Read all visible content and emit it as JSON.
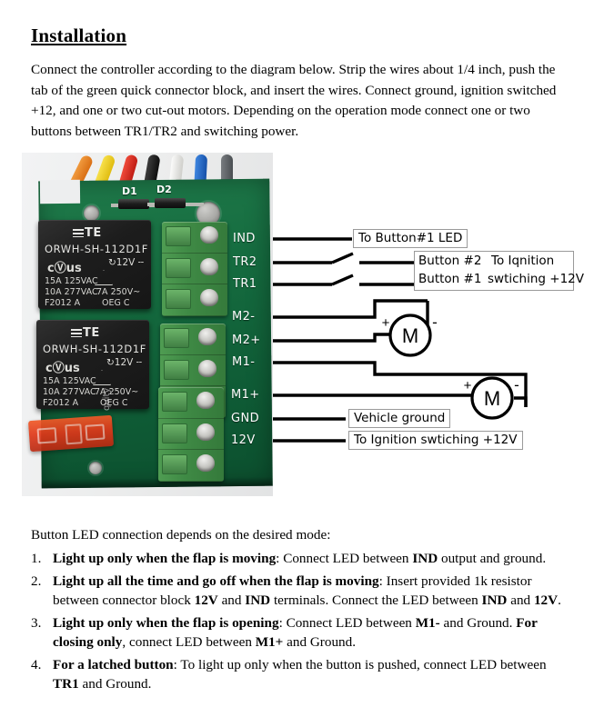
{
  "document": {
    "heading": "Installation",
    "intro": "Connect the controller according to the diagram below. Strip the wires about 1/4 inch, push the tab of the green quick connector block, and insert the wires. Connect ground, ignition switched +12, and one or two cut-out motors. Depending on the operation mode connect one or two buttons between TR1/TR2 and switching power.",
    "led_intro": "Button LED connection depends on the desired mode:",
    "led_modes": [
      {
        "number": "1.",
        "bold": "Light up only when the flap is moving",
        "rest": ": Connect LED between ",
        "term1": "IND",
        "rest2": " output and ground."
      },
      {
        "number": "2.",
        "bold": "Light up all the time and go off when the flap is moving",
        "rest": ": Insert provided 1k resistor between connector block ",
        "term1": "12V",
        "mid": " and ",
        "term2": "IND",
        "rest2": " terminals. Connect the LED between ",
        "term3": "IND",
        "mid2": " and ",
        "term4": "12V",
        "rest3": "."
      },
      {
        "number": "3.",
        "bold": "Light up only when the flap is opening",
        "rest": ": Connect LED between ",
        "term1": "M1-",
        "mid": " and Ground. ",
        "bold2": "For closing only",
        "rest2": ", connect LED between ",
        "term2": "M1+",
        "rest3": " and Ground."
      },
      {
        "number": "4.",
        "bold": "For a latched button",
        "rest": ": To light up only when the button is pushed, connect LED between ",
        "term1": "TR1",
        "rest2": " and Ground."
      }
    ]
  },
  "diagram": {
    "terminal_labels": [
      "IND",
      "TR2",
      "TR1",
      "M2-",
      "M2+",
      "M1-",
      "M1+",
      "GND",
      "12V"
    ],
    "annotations": {
      "button1_led": "To Button#1 LED",
      "button2": "Button #2",
      "button1": "Button #1",
      "to_ignition_line1": "To Iqnition",
      "to_ignition_line2": "swtiching +12V",
      "vehicle_ground": "Vehicle ground",
      "to_ignition_12v": "To Ignition swtiching +12V"
    },
    "motor_symbol": {
      "label": "M",
      "plus": "+",
      "minus": "-"
    },
    "motors": [
      {
        "name": "motor-1",
        "label": "M"
      },
      {
        "name": "motor-2",
        "label": "M"
      }
    ]
  },
  "board": {
    "diode_labels": [
      "D1",
      "D2"
    ],
    "silkscreen": "quity",
    "relays": [
      {
        "brand": "TE",
        "model": "ORWH-SH-112D1F",
        "ul": "us",
        "ul_prefix": "c",
        "coil": "12V",
        "rating1": "15A 125VAC",
        "rating2": "10A 277VAC",
        "rating3": "F2012  A",
        "rating4": "7A  250V~",
        "rating5": "OEG   C"
      },
      {
        "brand": "TE",
        "model": "ORWH-SH-112D1F",
        "ul": "us",
        "ul_prefix": "c",
        "coil": "12V",
        "rating1": "15A 125VAC",
        "rating2": "10A 277VAC",
        "rating3": "F2012  A",
        "rating4": "7A  250V~",
        "rating5": "OEG   C"
      }
    ],
    "wire_colors": [
      "#e8821e",
      "#f2cf1b",
      "#d8281c",
      "#1a1a1a",
      "#e9e9e7",
      "#1f63c4",
      "#5d6166"
    ]
  },
  "colors": {
    "pcb_green": "#15703f",
    "terminal_green": "#3f8a45",
    "fuse_orange": "#e0391a",
    "text": "#000000"
  }
}
